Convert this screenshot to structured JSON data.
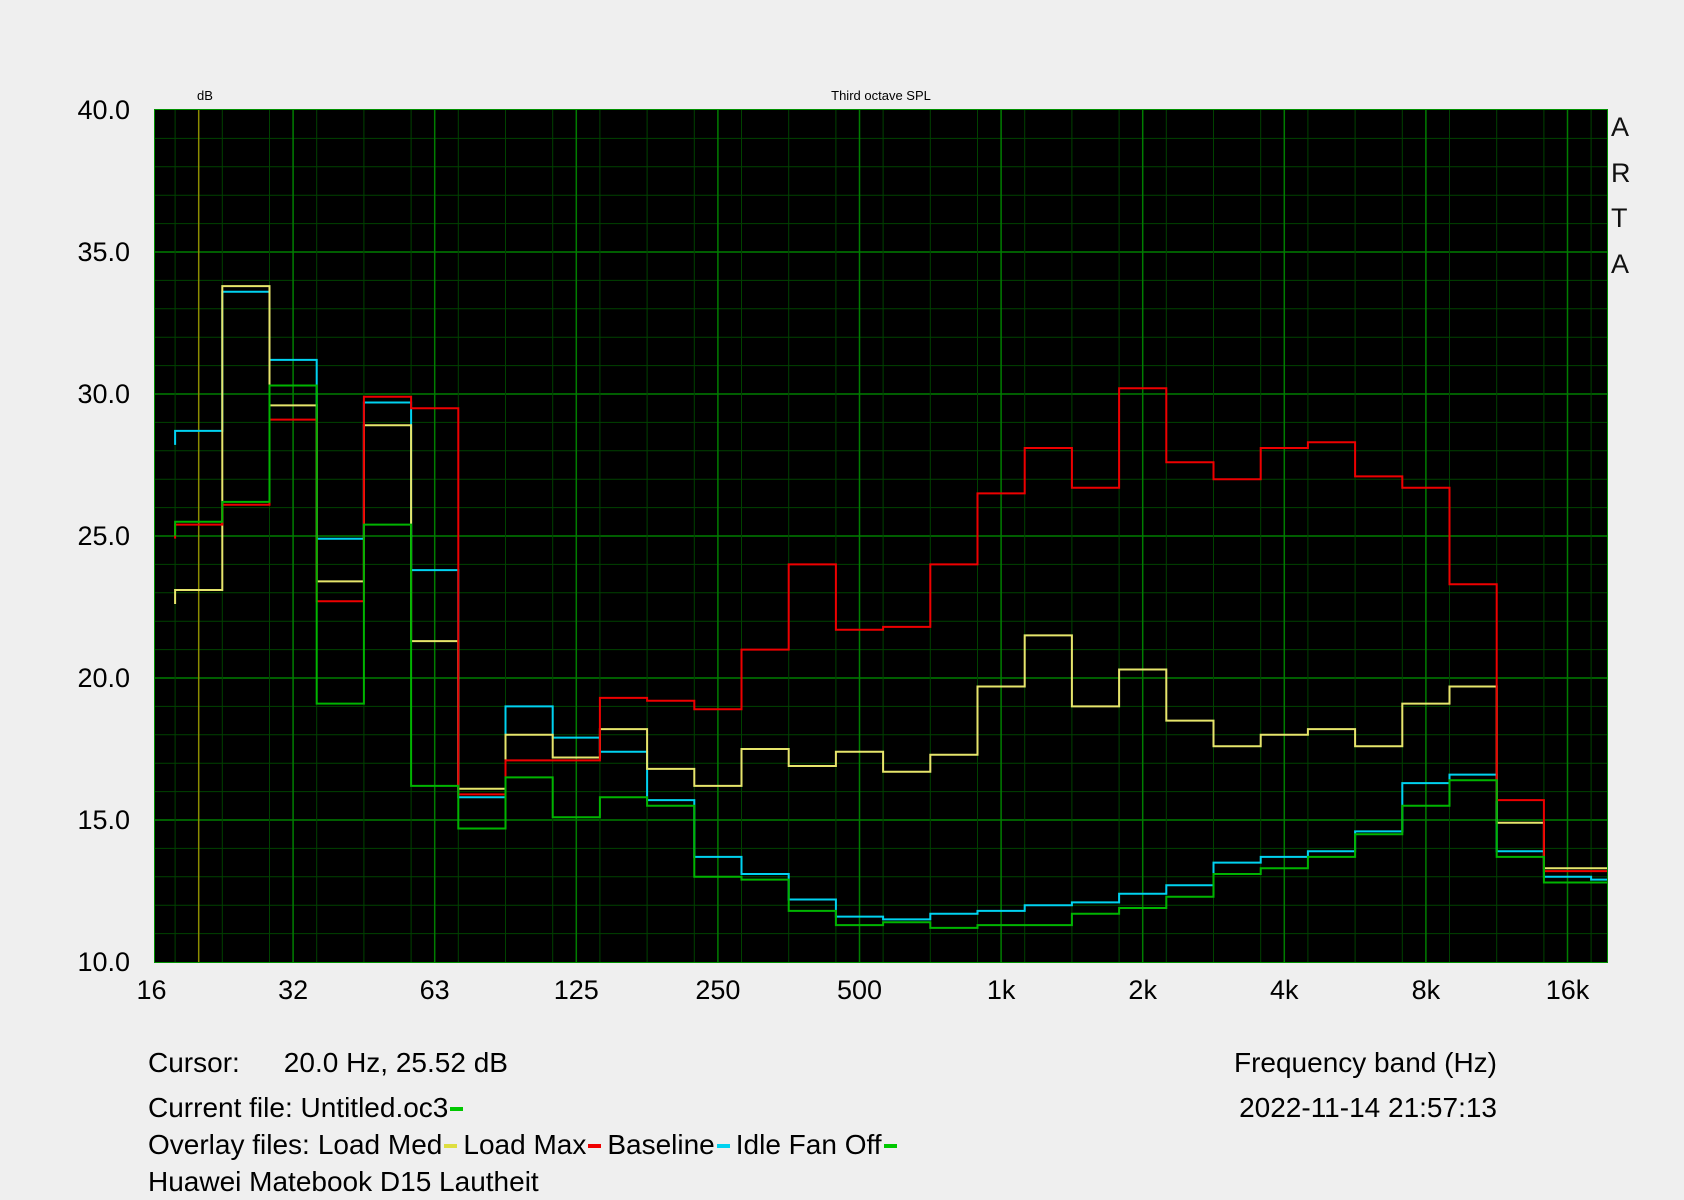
{
  "plot": {
    "db_unit_label": "dB",
    "title": "Third octave SPL",
    "brand_vertical": [
      "A",
      "R",
      "T",
      "A"
    ],
    "background": "#000000",
    "border_color": "#009000",
    "grid_minor_color": "#004200",
    "grid_major_color": "#007d00",
    "cursor_line_color": "#8c8c00",
    "cursor_freq_hz": 20.0
  },
  "y_axis": {
    "unit": "dB",
    "max": 40,
    "min": 10,
    "tick_labels": [
      "40.0",
      "35.0",
      "30.0",
      "25.0",
      "20.0",
      "15.0",
      "10.0"
    ]
  },
  "x_axis": {
    "label": "Frequency band (Hz)",
    "tick_labels": [
      "16",
      "32",
      "63",
      "125",
      "250",
      "500",
      "1k",
      "2k",
      "4k",
      "8k",
      "16k"
    ]
  },
  "status": {
    "cursor_label": "Cursor:",
    "cursor_value": "20.0 Hz, 25.52 dB",
    "current_file_label": "Current file:",
    "current_file_name": "Untitled.oc3",
    "current_file_marker_color": "#00c800",
    "datetime": "2022-11-14  21:57:13",
    "overlay_label": "Overlay files:",
    "device_note": "Huawei Matebook D15 Lautheit"
  },
  "overlays_legend": [
    {
      "name": "Load Med",
      "color": "#dede40"
    },
    {
      "name": "Load Max",
      "color": "#f00000"
    },
    {
      "name": "Baseline",
      "color": "#00d2f0"
    },
    {
      "name": "Idle Fan Off",
      "color": "#00c800"
    }
  ],
  "chart_data": {
    "type": "line",
    "subtype": "third-octave step (SPL)",
    "title": "Third octave SPL",
    "xlabel": "Frequency band (Hz)",
    "ylabel": "dB",
    "ylim": [
      10,
      40
    ],
    "grid": true,
    "x_octave_tick_centers_hz": [
      16,
      31.5,
      63,
      125,
      250,
      500,
      1000,
      2000,
      4000,
      8000,
      16000
    ],
    "bands_hz": [
      20,
      25,
      31.5,
      40,
      50,
      63,
      80,
      100,
      125,
      160,
      200,
      250,
      315,
      400,
      500,
      630,
      800,
      1000,
      1250,
      1600,
      2000,
      2500,
      3150,
      4000,
      5000,
      6300,
      8000,
      10000,
      12500,
      16000,
      20000
    ],
    "series": [
      {
        "name": "Baseline",
        "color": "#00d2f0",
        "values": [
          28.7,
          33.6,
          31.2,
          24.9,
          29.7,
          23.8,
          15.8,
          19.0,
          17.9,
          17.4,
          15.7,
          13.7,
          13.1,
          12.2,
          11.6,
          11.5,
          11.7,
          11.8,
          12.0,
          12.1,
          12.4,
          12.7,
          13.5,
          13.7,
          13.9,
          14.6,
          16.3,
          16.6,
          13.9,
          13.0,
          12.9
        ]
      },
      {
        "name": "Load Med",
        "color": "#e6e56b",
        "values": [
          23.1,
          33.8,
          29.6,
          23.4,
          28.9,
          21.3,
          16.1,
          18.0,
          17.2,
          18.2,
          16.8,
          16.2,
          17.5,
          16.9,
          17.4,
          16.7,
          17.3,
          19.7,
          21.5,
          19.0,
          20.3,
          18.5,
          17.6,
          18.0,
          18.2,
          17.6,
          19.1,
          19.7,
          14.9,
          13.3,
          13.3
        ]
      },
      {
        "name": "Load Max",
        "color": "#ee0000",
        "values": [
          25.4,
          26.1,
          29.1,
          22.7,
          29.9,
          29.5,
          15.9,
          17.1,
          17.1,
          19.3,
          19.2,
          18.9,
          21.0,
          24.0,
          21.7,
          21.8,
          24.0,
          26.5,
          28.1,
          26.7,
          30.2,
          27.6,
          27.0,
          28.1,
          28.3,
          27.1,
          26.7,
          23.3,
          15.7,
          13.2,
          13.2
        ]
      },
      {
        "name": "Idle Fan Off",
        "color": "#00b400",
        "values": [
          25.5,
          26.2,
          30.3,
          19.1,
          25.4,
          16.2,
          14.7,
          16.5,
          15.1,
          15.8,
          15.5,
          13.0,
          12.9,
          11.8,
          11.3,
          11.4,
          11.2,
          11.3,
          11.3,
          11.7,
          11.9,
          12.3,
          13.1,
          13.3,
          13.7,
          14.5,
          15.5,
          16.4,
          13.7,
          12.8,
          12.8
        ]
      }
    ]
  }
}
